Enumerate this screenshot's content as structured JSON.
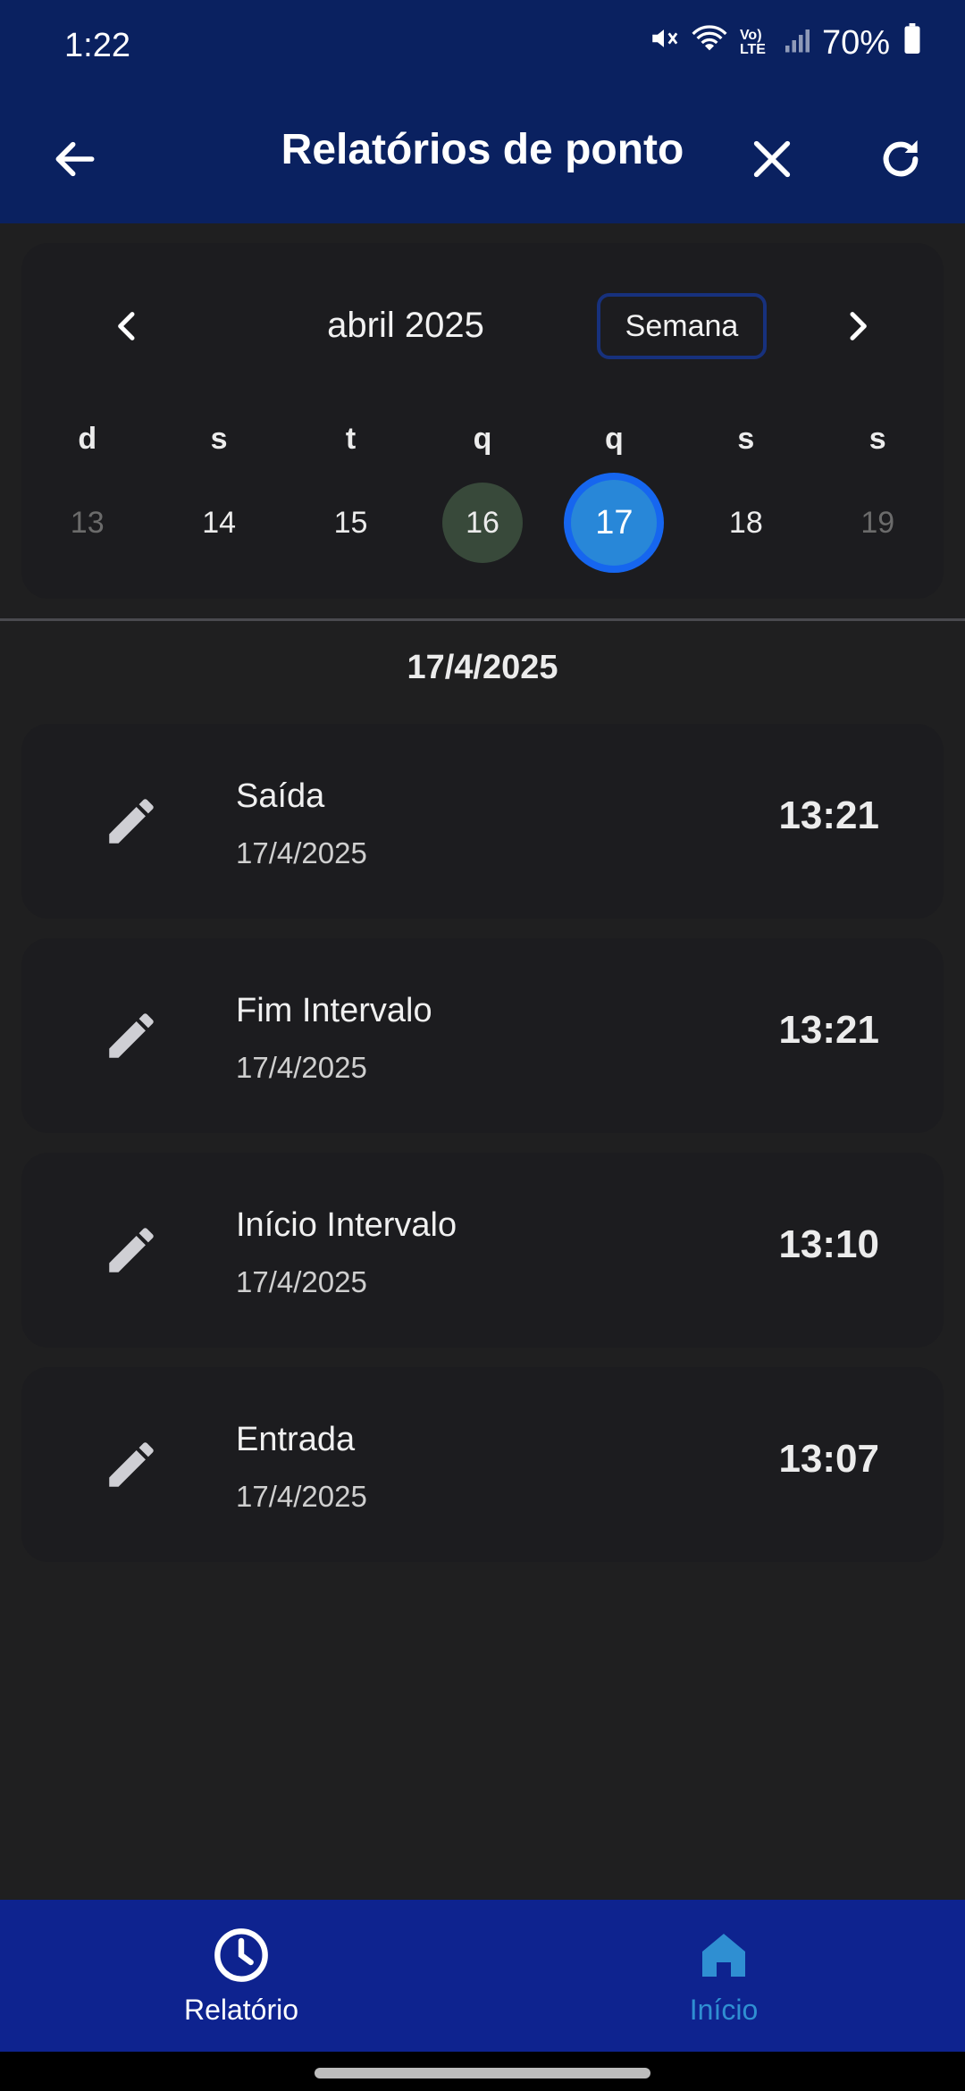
{
  "status_bar": {
    "time": "1:22",
    "battery": "70%",
    "network": "Vo) LTE"
  },
  "app_bar": {
    "title": "Relatórios de ponto",
    "icons": [
      "back-arrow-icon",
      "close-icon",
      "refresh-icon"
    ]
  },
  "calendar": {
    "month_label": "abril 2025",
    "view_mode": "Semana",
    "weekdays": [
      "d",
      "s",
      "t",
      "q",
      "q",
      "s",
      "s"
    ],
    "days": [
      "13",
      "14",
      "15",
      "16",
      "17",
      "18",
      "19"
    ],
    "today": "16",
    "selected": "17"
  },
  "selected_date": "17/4/2025",
  "records": [
    {
      "type": "Saída",
      "date": "17/4/2025",
      "time": "13:21"
    },
    {
      "type": "Fim Intervalo",
      "date": "17/4/2025",
      "time": "13:21"
    },
    {
      "type": "Início Intervalo",
      "date": "17/4/2025",
      "time": "13:10"
    },
    {
      "type": "Entrada",
      "date": "17/4/2025",
      "time": "13:07"
    }
  ],
  "bottom_nav": {
    "items": [
      {
        "label": "Relatório",
        "icon": "clock-icon",
        "active": true
      },
      {
        "label": "Início",
        "icon": "home-icon",
        "active": false
      }
    ]
  },
  "colors": {
    "header_bg": "#0a2160",
    "bottom_nav_bg": "#0e238f",
    "selected_day": "#1666ef",
    "today_day": "#38493a",
    "inactive_nav": "#2f8fd2"
  }
}
